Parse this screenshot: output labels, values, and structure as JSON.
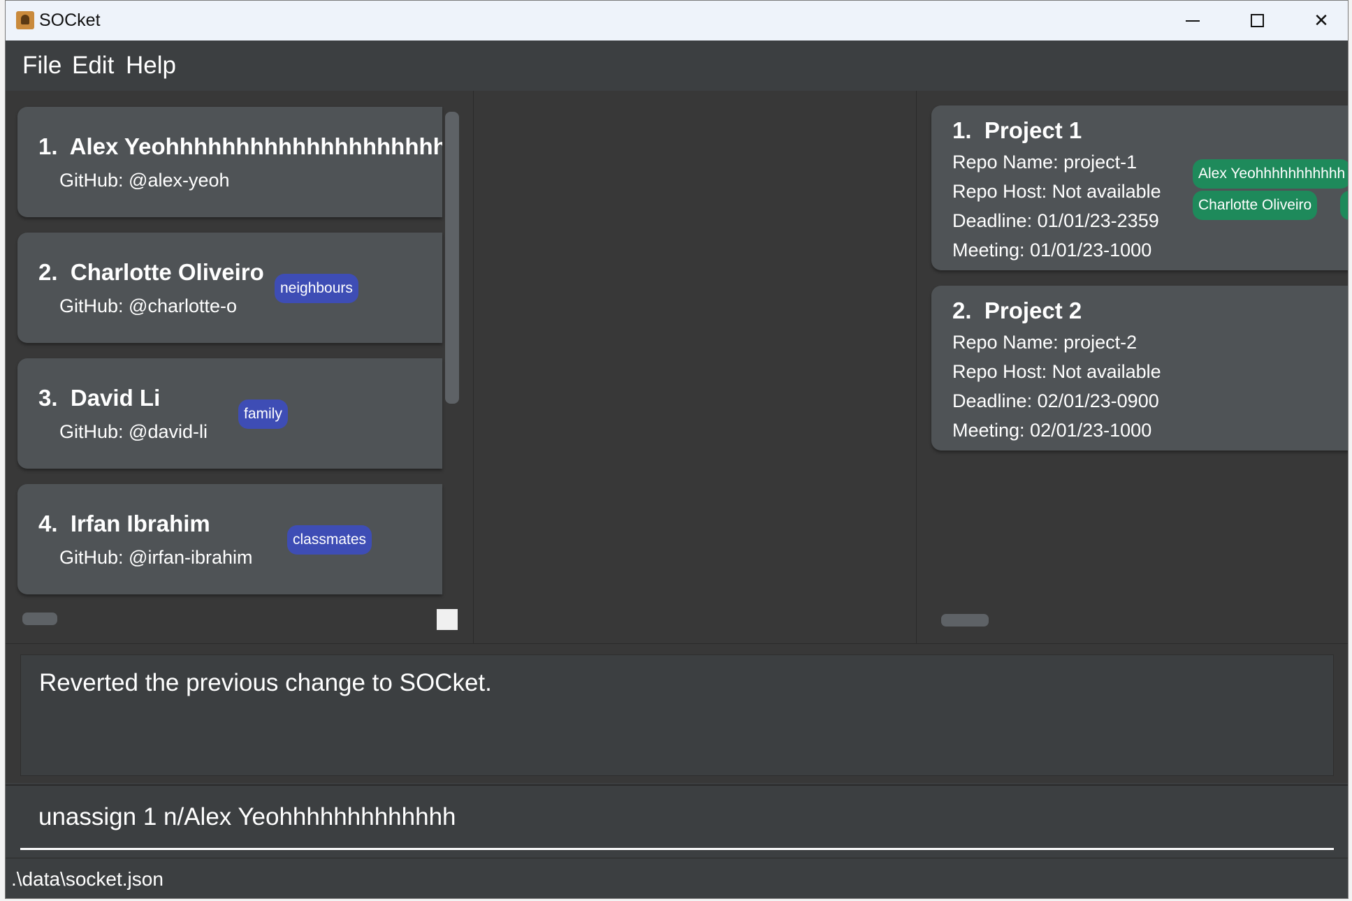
{
  "window": {
    "title": "SOCket"
  },
  "menu": [
    "File",
    "Edit",
    "Help"
  ],
  "persons": [
    {
      "index": "1.",
      "name": "Alex Yeohhhhhhhhhhhhhhhhhhhhhhhh",
      "github": "GitHub: @alex-yeoh",
      "tags": []
    },
    {
      "index": "2.",
      "name": "Charlotte Oliveiro",
      "github": "GitHub: @charlotte-o",
      "tags": [
        "neighbours"
      ]
    },
    {
      "index": "3.",
      "name": "David Li",
      "github": "GitHub: @david-li",
      "tags": [
        "family"
      ]
    },
    {
      "index": "4.",
      "name": "Irfan Ibrahim",
      "github": "GitHub: @irfan-ibrahim",
      "tags": [
        "classmates"
      ]
    }
  ],
  "projects": [
    {
      "index": "1.",
      "name": "Project 1",
      "repo_name": "Repo Name: project-1",
      "repo_host": "Repo Host: Not available",
      "deadline": "Deadline: 01/01/23-2359",
      "meeting": "Meeting: 01/01/23-1000",
      "members": [
        "Alex Yeohhhhhhhhhhh",
        "Charlotte Oliveiro"
      ]
    },
    {
      "index": "2.",
      "name": "Project 2",
      "repo_name": "Repo Name: project-2",
      "repo_host": "Repo Host: Not available",
      "deadline": "Deadline: 02/01/23-0900",
      "meeting": "Meeting: 02/01/23-1000",
      "members": []
    }
  ],
  "result_message": "Reverted the previous change to SOCket.",
  "command": {
    "value": "unassign 1 n/Alex Yeohhhhhhhhhhhhh"
  },
  "status": {
    "file_path": ".\\data\\socket.json"
  },
  "colors": {
    "tag_person": "#3e4db5",
    "tag_member": "#1e8a5b",
    "card": "#4f5356",
    "panel": "#383838"
  }
}
